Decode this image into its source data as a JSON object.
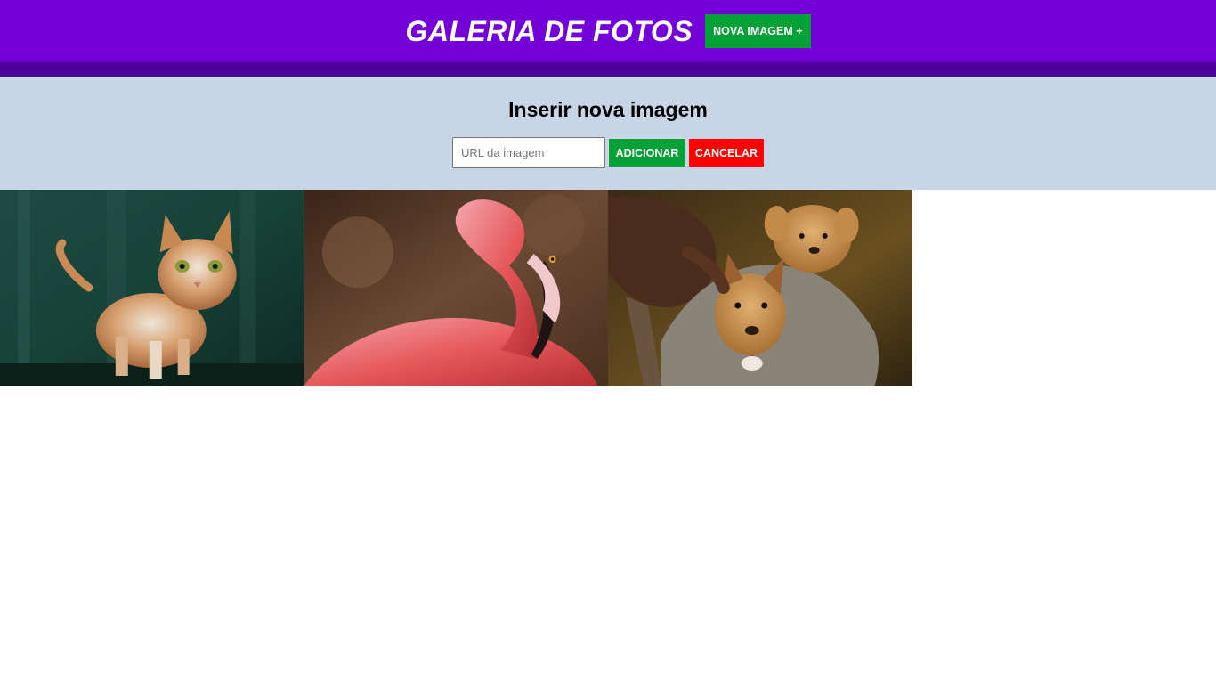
{
  "header": {
    "title": "GALERIA DE FOTOS",
    "new_image_button": "NOVA IMAGEM +",
    "colors": {
      "bar": "#7300d6",
      "strip": "#4e0099",
      "button": "#03a136"
    }
  },
  "form": {
    "title": "Inserir nova imagem",
    "url_placeholder": "URL da imagem",
    "url_value": "",
    "add_button": "ADICIONAR",
    "cancel_button": "CANCELAR",
    "colors": {
      "panel": "#c8d5e7",
      "add": "#03a136",
      "cancel": "#ff0000"
    }
  },
  "gallery": {
    "images": [
      {
        "subject": "cat-photo"
      },
      {
        "subject": "flamingo-photo"
      },
      {
        "subject": "puppies-photo"
      }
    ]
  }
}
